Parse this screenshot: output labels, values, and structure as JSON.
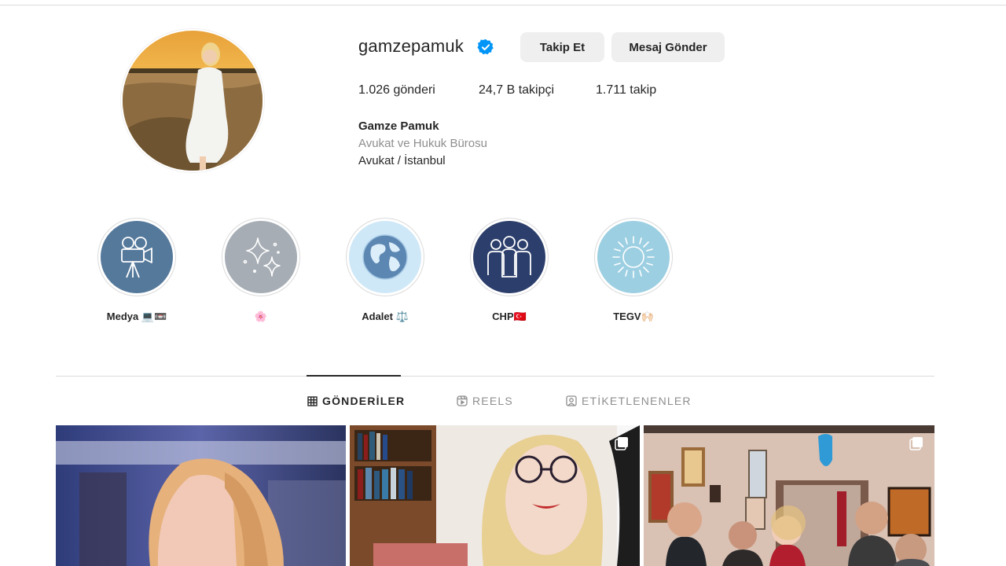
{
  "profile": {
    "username": "gamzepamuk",
    "verified": true,
    "follow_label": "Takip Et",
    "message_label": "Mesaj Gönder",
    "posts": "1.026 gönderi",
    "followers": "24,7 B takipçi",
    "following": "1.711 takip",
    "full_name": "Gamze Pamuk",
    "category": "Avukat ve Hukuk Bürosu",
    "bio": "Avukat / İstanbul"
  },
  "highlights": [
    {
      "label": "Medya 💻📼",
      "icon": "film-camera-icon",
      "color": "#55799b"
    },
    {
      "label": "🌸",
      "icon": "sparkles-icon",
      "color": "#a6adb4"
    },
    {
      "label": "Adalet ⚖️",
      "icon": "globe-icon",
      "color": "#cfe8f7"
    },
    {
      "label": "CHP🇹🇷",
      "icon": "group-icon",
      "color": "#2c3e6b"
    },
    {
      "label": "TEGV🙌🏻",
      "icon": "sun-icon",
      "color": "#9ccfe2"
    }
  ],
  "tabs": [
    {
      "label": "GÖNDERİLER",
      "icon": "grid-icon",
      "active": true
    },
    {
      "label": "REELS",
      "icon": "reels-icon",
      "active": false
    },
    {
      "label": "ETİKETLENENLER",
      "icon": "tagged-icon",
      "active": false
    }
  ],
  "colors": {
    "accent": "#0095f6",
    "button_bg": "#efefef",
    "text": "#262626",
    "muted": "#8e8e8e"
  }
}
